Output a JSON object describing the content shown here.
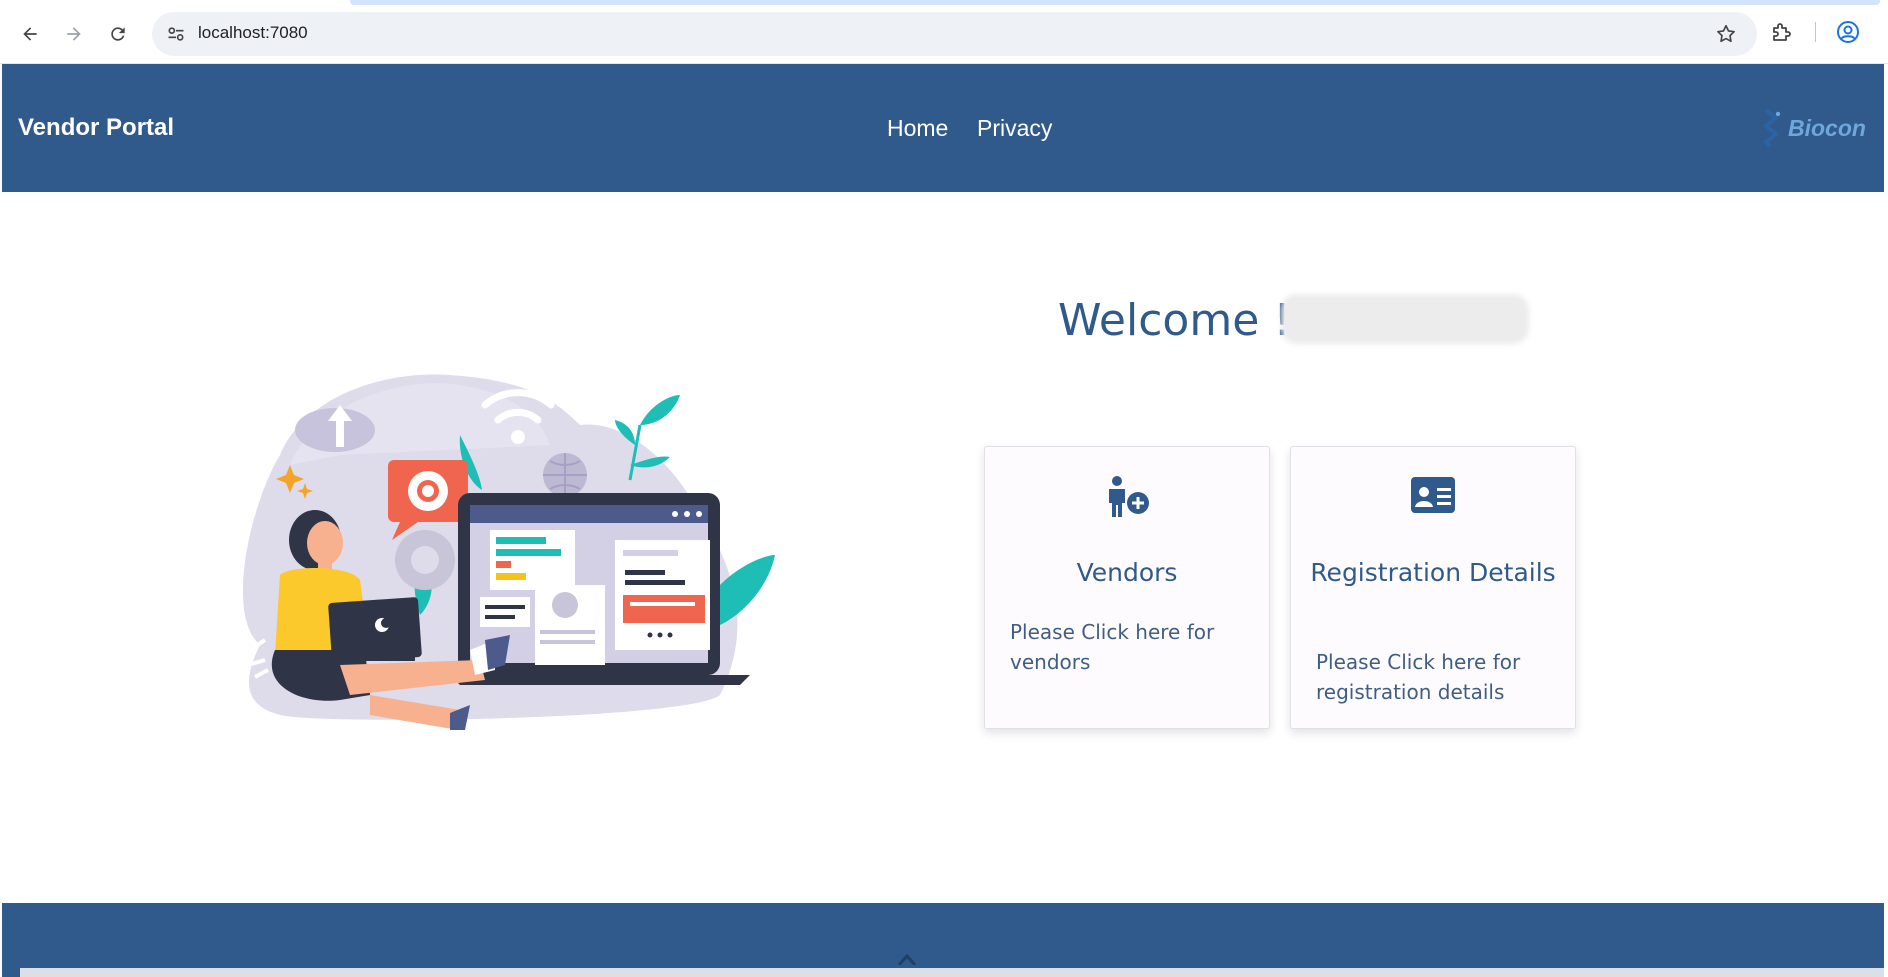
{
  "browser": {
    "url": "localhost:7080"
  },
  "header": {
    "brand": "Vendor Portal",
    "nav": [
      {
        "label": "Home"
      },
      {
        "label": "Privacy"
      }
    ],
    "logo_text": "Biocon"
  },
  "main": {
    "welcome": "Welcome !",
    "cards": [
      {
        "title": "Vendors",
        "description": "Please Click here for vendors",
        "icon": "add-person-icon"
      },
      {
        "title": "Registration Details",
        "description": "Please Click here for registration details",
        "icon": "id-card-icon"
      }
    ]
  },
  "colors": {
    "primary": "#2f5a8b",
    "logo": "#6fa7dd"
  }
}
